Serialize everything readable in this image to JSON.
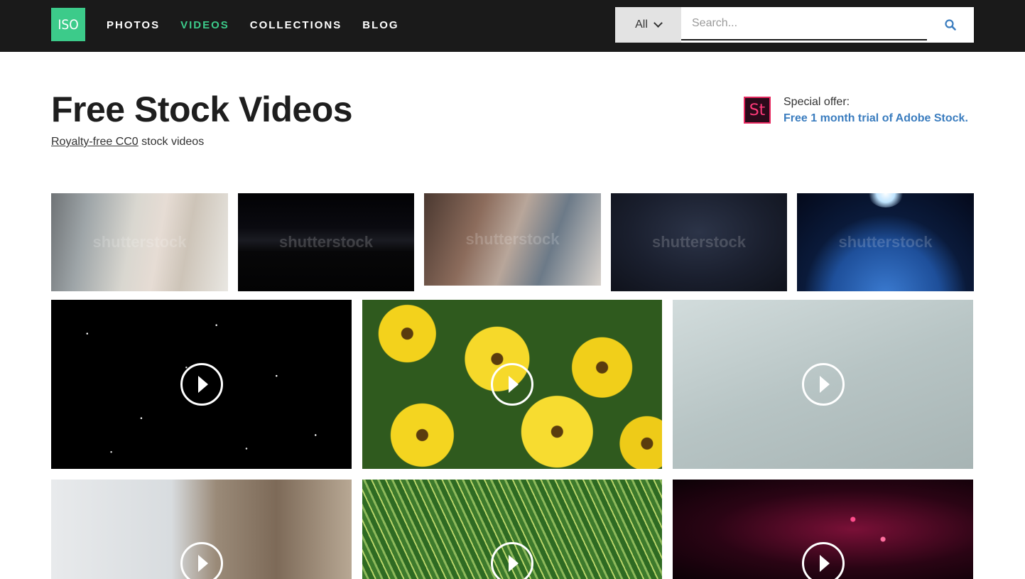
{
  "logo": {
    "text": "ISO"
  },
  "nav": {
    "items": [
      {
        "label": "PHOTOS",
        "active": false
      },
      {
        "label": "VIDEOS",
        "active": true
      },
      {
        "label": "COLLECTIONS",
        "active": false
      },
      {
        "label": "BLOG",
        "active": false
      }
    ]
  },
  "search": {
    "scope_label": "All",
    "placeholder": "Search..."
  },
  "hero": {
    "title": "Free Stock Videos",
    "subtitle_link": "Royalty-free CC0",
    "subtitle_rest": " stock videos"
  },
  "offer": {
    "icon_text": "St",
    "label": "Special offer:",
    "link_text": "Free 1 month trial of Adobe Stock."
  },
  "watermark": "shutterstock",
  "colors": {
    "accent": "#3ccb8a",
    "topbar": "#1a1a1a",
    "link": "#3b7dbf"
  }
}
